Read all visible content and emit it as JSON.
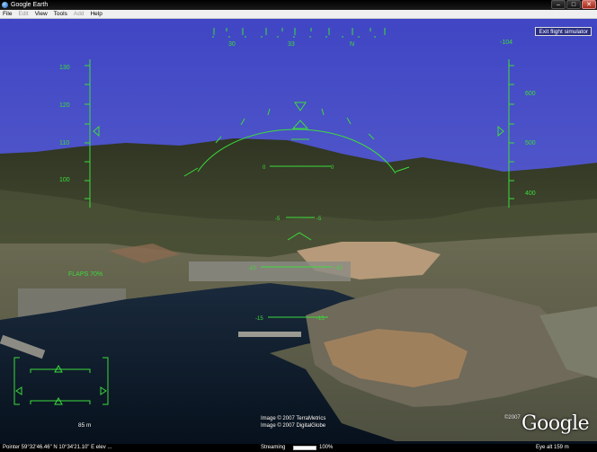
{
  "window": {
    "title": "Google Earth",
    "minimize": "–",
    "maximize": "□",
    "close": "✕"
  },
  "menu": [
    "File",
    "Edit",
    "View",
    "Tools",
    "Add",
    "Help"
  ],
  "hud": {
    "exit_label": "Exit flight simulator",
    "heading_labels": [
      "30",
      "33",
      "N"
    ],
    "heading_readout": "-104",
    "speed_ticks": [
      "130",
      "120",
      "110",
      "100"
    ],
    "altitude_ticks": [
      "600",
      "500",
      "400"
    ],
    "flaps_label": "FLAPS 70%",
    "pitch_marks": [
      {
        "left": "0",
        "right": "0"
      },
      {
        "left": "-5",
        "right": "-5"
      },
      {
        "left": "-10",
        "right": "-10"
      },
      {
        "left": "-15",
        "right": "-15"
      }
    ]
  },
  "credits": {
    "line1": "Image © 2007 TerraMetrics",
    "line2": "Image © 2007 DigitalGlobe",
    "copyright": "©2007",
    "logo": "Google"
  },
  "scale_label": "85 m",
  "status": {
    "pointer": "Pointer  59°32'46.46\" N   10°34'21.10\" E   elev  ...",
    "streaming": "Streaming",
    "streaming_pct": "100%",
    "eye_alt": "Eye alt    159 m"
  },
  "colors": {
    "hud": "#3bdc3b",
    "sky": "#4b50c8",
    "water": "#0b1a2a"
  }
}
